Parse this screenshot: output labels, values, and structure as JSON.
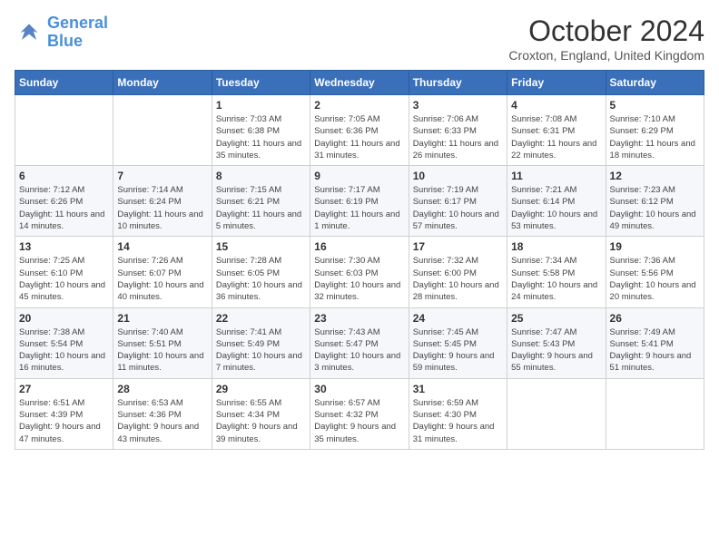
{
  "logo": {
    "line1": "General",
    "line2": "Blue"
  },
  "title": "October 2024",
  "location": "Croxton, England, United Kingdom",
  "days_of_week": [
    "Sunday",
    "Monday",
    "Tuesday",
    "Wednesday",
    "Thursday",
    "Friday",
    "Saturday"
  ],
  "weeks": [
    [
      {
        "day": "",
        "info": ""
      },
      {
        "day": "",
        "info": ""
      },
      {
        "day": "1",
        "info": "Sunrise: 7:03 AM\nSunset: 6:38 PM\nDaylight: 11 hours and 35 minutes."
      },
      {
        "day": "2",
        "info": "Sunrise: 7:05 AM\nSunset: 6:36 PM\nDaylight: 11 hours and 31 minutes."
      },
      {
        "day": "3",
        "info": "Sunrise: 7:06 AM\nSunset: 6:33 PM\nDaylight: 11 hours and 26 minutes."
      },
      {
        "day": "4",
        "info": "Sunrise: 7:08 AM\nSunset: 6:31 PM\nDaylight: 11 hours and 22 minutes."
      },
      {
        "day": "5",
        "info": "Sunrise: 7:10 AM\nSunset: 6:29 PM\nDaylight: 11 hours and 18 minutes."
      }
    ],
    [
      {
        "day": "6",
        "info": "Sunrise: 7:12 AM\nSunset: 6:26 PM\nDaylight: 11 hours and 14 minutes."
      },
      {
        "day": "7",
        "info": "Sunrise: 7:14 AM\nSunset: 6:24 PM\nDaylight: 11 hours and 10 minutes."
      },
      {
        "day": "8",
        "info": "Sunrise: 7:15 AM\nSunset: 6:21 PM\nDaylight: 11 hours and 5 minutes."
      },
      {
        "day": "9",
        "info": "Sunrise: 7:17 AM\nSunset: 6:19 PM\nDaylight: 11 hours and 1 minute."
      },
      {
        "day": "10",
        "info": "Sunrise: 7:19 AM\nSunset: 6:17 PM\nDaylight: 10 hours and 57 minutes."
      },
      {
        "day": "11",
        "info": "Sunrise: 7:21 AM\nSunset: 6:14 PM\nDaylight: 10 hours and 53 minutes."
      },
      {
        "day": "12",
        "info": "Sunrise: 7:23 AM\nSunset: 6:12 PM\nDaylight: 10 hours and 49 minutes."
      }
    ],
    [
      {
        "day": "13",
        "info": "Sunrise: 7:25 AM\nSunset: 6:10 PM\nDaylight: 10 hours and 45 minutes."
      },
      {
        "day": "14",
        "info": "Sunrise: 7:26 AM\nSunset: 6:07 PM\nDaylight: 10 hours and 40 minutes."
      },
      {
        "day": "15",
        "info": "Sunrise: 7:28 AM\nSunset: 6:05 PM\nDaylight: 10 hours and 36 minutes."
      },
      {
        "day": "16",
        "info": "Sunrise: 7:30 AM\nSunset: 6:03 PM\nDaylight: 10 hours and 32 minutes."
      },
      {
        "day": "17",
        "info": "Sunrise: 7:32 AM\nSunset: 6:00 PM\nDaylight: 10 hours and 28 minutes."
      },
      {
        "day": "18",
        "info": "Sunrise: 7:34 AM\nSunset: 5:58 PM\nDaylight: 10 hours and 24 minutes."
      },
      {
        "day": "19",
        "info": "Sunrise: 7:36 AM\nSunset: 5:56 PM\nDaylight: 10 hours and 20 minutes."
      }
    ],
    [
      {
        "day": "20",
        "info": "Sunrise: 7:38 AM\nSunset: 5:54 PM\nDaylight: 10 hours and 16 minutes."
      },
      {
        "day": "21",
        "info": "Sunrise: 7:40 AM\nSunset: 5:51 PM\nDaylight: 10 hours and 11 minutes."
      },
      {
        "day": "22",
        "info": "Sunrise: 7:41 AM\nSunset: 5:49 PM\nDaylight: 10 hours and 7 minutes."
      },
      {
        "day": "23",
        "info": "Sunrise: 7:43 AM\nSunset: 5:47 PM\nDaylight: 10 hours and 3 minutes."
      },
      {
        "day": "24",
        "info": "Sunrise: 7:45 AM\nSunset: 5:45 PM\nDaylight: 9 hours and 59 minutes."
      },
      {
        "day": "25",
        "info": "Sunrise: 7:47 AM\nSunset: 5:43 PM\nDaylight: 9 hours and 55 minutes."
      },
      {
        "day": "26",
        "info": "Sunrise: 7:49 AM\nSunset: 5:41 PM\nDaylight: 9 hours and 51 minutes."
      }
    ],
    [
      {
        "day": "27",
        "info": "Sunrise: 6:51 AM\nSunset: 4:39 PM\nDaylight: 9 hours and 47 minutes."
      },
      {
        "day": "28",
        "info": "Sunrise: 6:53 AM\nSunset: 4:36 PM\nDaylight: 9 hours and 43 minutes."
      },
      {
        "day": "29",
        "info": "Sunrise: 6:55 AM\nSunset: 4:34 PM\nDaylight: 9 hours and 39 minutes."
      },
      {
        "day": "30",
        "info": "Sunrise: 6:57 AM\nSunset: 4:32 PM\nDaylight: 9 hours and 35 minutes."
      },
      {
        "day": "31",
        "info": "Sunrise: 6:59 AM\nSunset: 4:30 PM\nDaylight: 9 hours and 31 minutes."
      },
      {
        "day": "",
        "info": ""
      },
      {
        "day": "",
        "info": ""
      }
    ]
  ]
}
